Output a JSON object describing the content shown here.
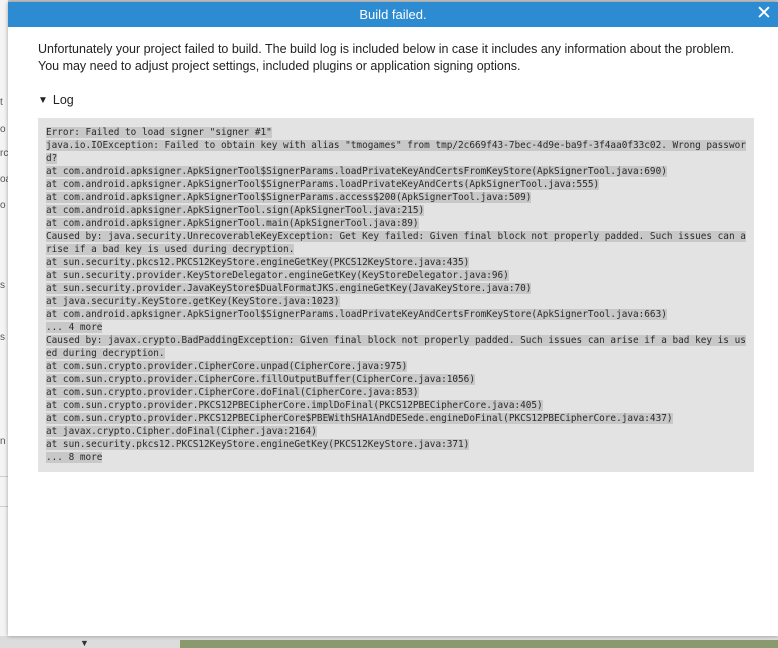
{
  "background": {
    "fragments": [
      "t",
      "o",
      "rc",
      "oa",
      "o",
      "s",
      "s",
      "n"
    ],
    "caret": "▼"
  },
  "dialog": {
    "title": "Build failed.",
    "close_glyph": "✕",
    "message": "Unfortunately your project failed to build. The build log is included below in case it includes any information about the problem. You may need to adjust project settings, included plugins or application signing options.",
    "log_toggle_icon": "▼",
    "log_toggle_label": "Log",
    "log_lines": [
      "Error: Failed to load signer \"signer #1\"",
      "java.io.IOException: Failed to obtain key with alias \"tmogames\" from tmp/2c669f43-7bec-4d9e-ba9f-3f4aa0f33c02. Wrong password?",
      "at com.android.apksigner.ApkSignerTool$SignerParams.loadPrivateKeyAndCertsFromKeyStore(ApkSignerTool.java:690)",
      "at com.android.apksigner.ApkSignerTool$SignerParams.loadPrivateKeyAndCerts(ApkSignerTool.java:555)",
      "at com.android.apksigner.ApkSignerTool$SignerParams.access$200(ApkSignerTool.java:509)",
      "at com.android.apksigner.ApkSignerTool.sign(ApkSignerTool.java:215)",
      "at com.android.apksigner.ApkSignerTool.main(ApkSignerTool.java:89)",
      "Caused by: java.security.UnrecoverableKeyException: Get Key failed: Given final block not properly padded. Such issues can arise if a bad key is used during decryption.",
      "at sun.security.pkcs12.PKCS12KeyStore.engineGetKey(PKCS12KeyStore.java:435)",
      "at sun.security.provider.KeyStoreDelegator.engineGetKey(KeyStoreDelegator.java:96)",
      "at sun.security.provider.JavaKeyStore$DualFormatJKS.engineGetKey(JavaKeyStore.java:70)",
      "at java.security.KeyStore.getKey(KeyStore.java:1023)",
      "at com.android.apksigner.ApkSignerTool$SignerParams.loadPrivateKeyAndCertsFromKeyStore(ApkSignerTool.java:663)",
      "... 4 more",
      "Caused by: javax.crypto.BadPaddingException: Given final block not properly padded. Such issues can arise if a bad key is used during decryption.",
      "at com.sun.crypto.provider.CipherCore.unpad(CipherCore.java:975)",
      "at com.sun.crypto.provider.CipherCore.fillOutputBuffer(CipherCore.java:1056)",
      "at com.sun.crypto.provider.CipherCore.doFinal(CipherCore.java:853)",
      "at com.sun.crypto.provider.PKCS12PBECipherCore.implDoFinal(PKCS12PBECipherCore.java:405)",
      "at com.sun.crypto.provider.PKCS12PBECipherCore$PBEWithSHA1AndDESede.engineDoFinal(PKCS12PBECipherCore.java:437)",
      "at javax.crypto.Cipher.doFinal(Cipher.java:2164)",
      "at sun.security.pkcs12.PKCS12KeyStore.engineGetKey(PKCS12KeyStore.java:371)",
      "... 8 more"
    ]
  },
  "colors": {
    "titlebar": "#2d8bd2",
    "log_background": "#e3e3e3",
    "log_highlight": "#c8c8c8"
  }
}
